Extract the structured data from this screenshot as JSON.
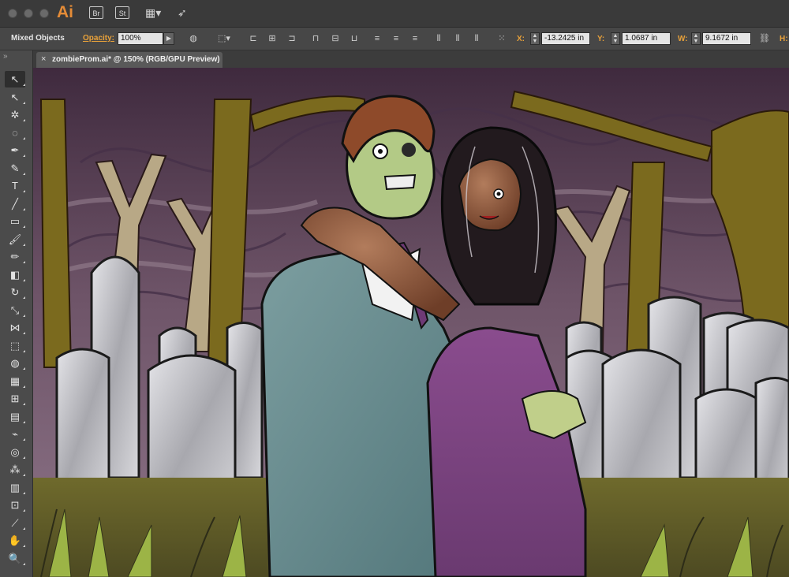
{
  "app": {
    "logo": "Ai",
    "bridge_label": "Br",
    "stock_label": "St"
  },
  "control_bar": {
    "selection_label": "Mixed Objects",
    "opacity_label": "Opacity:",
    "opacity_value": "100%",
    "x_label": "X:",
    "x_value": "-13.2425 in",
    "y_label": "Y:",
    "y_value": "1.0687 in",
    "w_label": "W:",
    "w_value": "9.1672 in",
    "h_label": "H:"
  },
  "document": {
    "tab_label": "zombieProm.ai* @ 150% (RGB/GPU Preview)",
    "close_glyph": "×"
  },
  "tools": [
    {
      "name": "selection-tool",
      "glyph": "↖"
    },
    {
      "name": "direct-selection-tool",
      "glyph": "↖"
    },
    {
      "name": "magic-wand-tool",
      "glyph": "✲"
    },
    {
      "name": "lasso-tool",
      "glyph": "◌"
    },
    {
      "name": "pen-tool",
      "glyph": "✒"
    },
    {
      "name": "curvature-tool",
      "glyph": "✎"
    },
    {
      "name": "type-tool",
      "glyph": "T"
    },
    {
      "name": "line-segment-tool",
      "glyph": "╱"
    },
    {
      "name": "rectangle-tool",
      "glyph": "▭"
    },
    {
      "name": "paintbrush-tool",
      "glyph": "🖌"
    },
    {
      "name": "shaper-tool",
      "glyph": "✏"
    },
    {
      "name": "eraser-tool",
      "glyph": "◧"
    },
    {
      "name": "rotate-tool",
      "glyph": "↻"
    },
    {
      "name": "scale-tool",
      "glyph": "⤡"
    },
    {
      "name": "width-tool",
      "glyph": "⋈"
    },
    {
      "name": "free-transform-tool",
      "glyph": "⬚"
    },
    {
      "name": "shape-builder-tool",
      "glyph": "◍"
    },
    {
      "name": "perspective-grid-tool",
      "glyph": "▦"
    },
    {
      "name": "mesh-tool",
      "glyph": "⊞"
    },
    {
      "name": "gradient-tool",
      "glyph": "▤"
    },
    {
      "name": "eyedropper-tool",
      "glyph": "⌁"
    },
    {
      "name": "blend-tool",
      "glyph": "◎"
    },
    {
      "name": "symbol-sprayer-tool",
      "glyph": "⁂"
    },
    {
      "name": "column-graph-tool",
      "glyph": "▥"
    },
    {
      "name": "artboard-tool",
      "glyph": "⊡"
    },
    {
      "name": "slice-tool",
      "glyph": "⟋"
    },
    {
      "name": "hand-tool",
      "glyph": "✋"
    },
    {
      "name": "zoom-tool",
      "glyph": "🔍"
    }
  ]
}
